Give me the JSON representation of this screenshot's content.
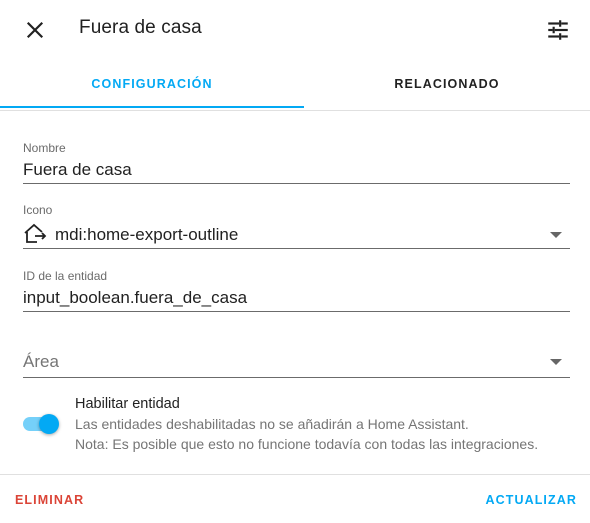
{
  "dialog": {
    "title": "Fuera de casa"
  },
  "header": {
    "close_icon": "close-icon",
    "settings_icon": "tune-icon"
  },
  "tabs": [
    {
      "label": "CONFIGURACIÓN",
      "active": true
    },
    {
      "label": "RELACIONADO",
      "active": false
    }
  ],
  "form": {
    "name": {
      "label": "Nombre",
      "value": "Fuera de casa"
    },
    "icon": {
      "label": "Icono",
      "value": "mdi:home-export-outline",
      "icon_name": "home-export-outline-icon"
    },
    "entity_id": {
      "label": "ID de la entidad",
      "value": "input_boolean.fuera_de_casa"
    },
    "area": {
      "placeholder": "Área"
    }
  },
  "enable": {
    "title": "Habilitar entidad",
    "enabled": true,
    "description": "Las entidades deshabilitadas no se añadirán a Home Assistant.",
    "note": "Nota: Es posible que esto no funcione todavía con todas las integraciones."
  },
  "actions": {
    "delete_label": "ELIMINAR",
    "update_label": "ACTUALIZAR"
  },
  "colors": {
    "accent": "#03a9f4",
    "danger": "#db4437",
    "text": "#212121",
    "secondary_text": "#757575"
  }
}
